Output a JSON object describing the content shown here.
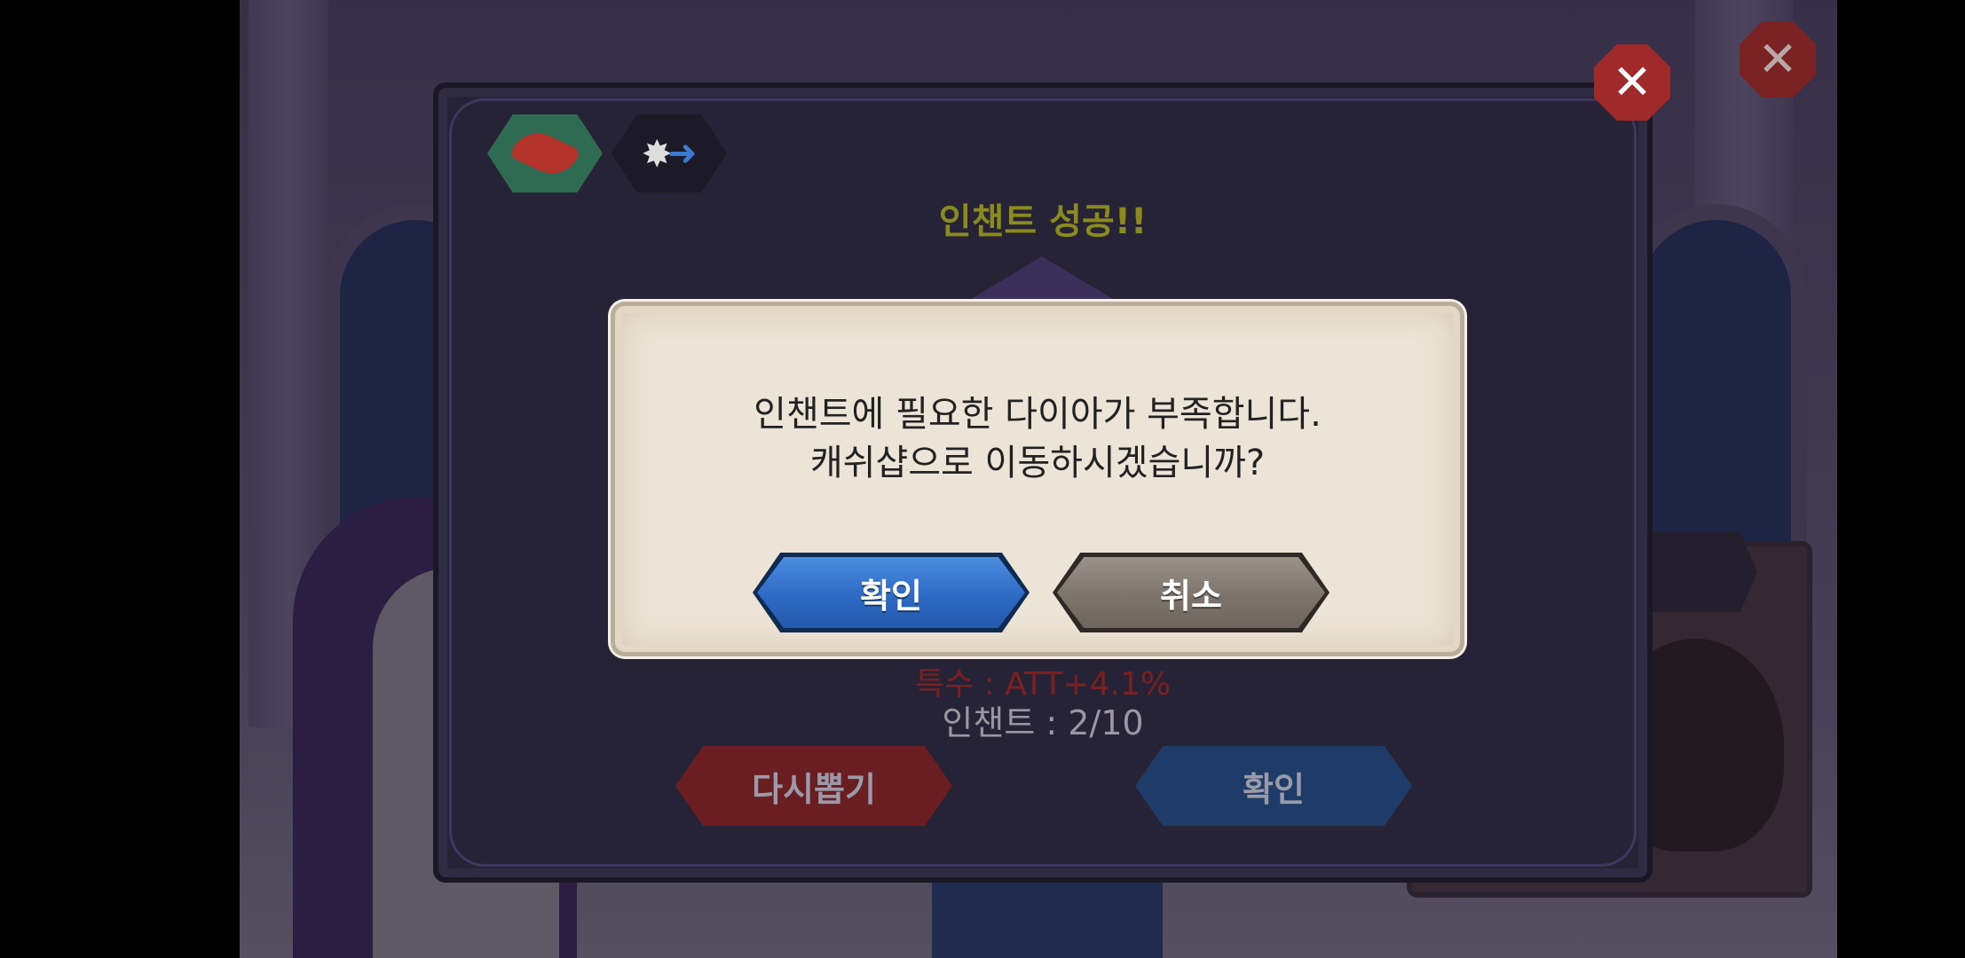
{
  "panel": {
    "title": "인챈트 성공!!",
    "stat_special": "특수 : ATT+4.1%",
    "stat_enchant": "인챈트 : 2/10",
    "reroll_label": "다시뽑기",
    "confirm_label": "확인"
  },
  "dialog": {
    "line1": "인챈트에 필요한 다이아가 부족합니다.",
    "line2": "캐쉬샵으로 이동하시겠습니까?",
    "ok_label": "확인",
    "cancel_label": "취소"
  },
  "icons": {
    "close": "close-icon",
    "item": "item-claw-icon",
    "effect": "enchant-effect-icon"
  },
  "colors": {
    "title": "#8a8a1e",
    "ok_button": "#2d6ac4",
    "cancel_button": "#7d756c",
    "reroll_button": "#6a1e22",
    "close_button": "#a02a2a"
  }
}
